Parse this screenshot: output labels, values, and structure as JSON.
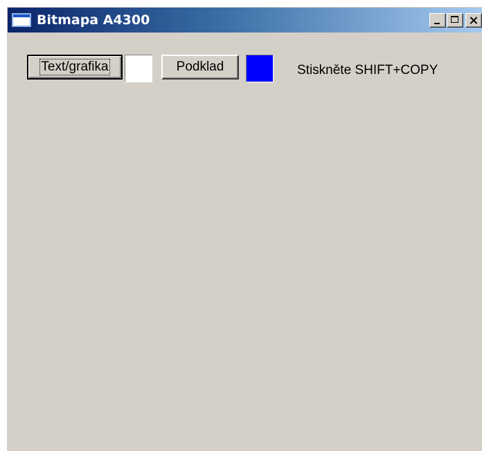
{
  "window": {
    "title": "Bitmapa A4300"
  },
  "toolbar": {
    "text_graphics_label": "Text/grafika",
    "text_color": "#ffffff",
    "background_label": "Podklad",
    "background_color": "#0000ff",
    "hint": "Stiskněte SHIFT+COPY"
  },
  "icons": {
    "app": "window-icon",
    "minimize": "minimize-icon",
    "maximize": "maximize-icon",
    "close": "close-icon"
  }
}
